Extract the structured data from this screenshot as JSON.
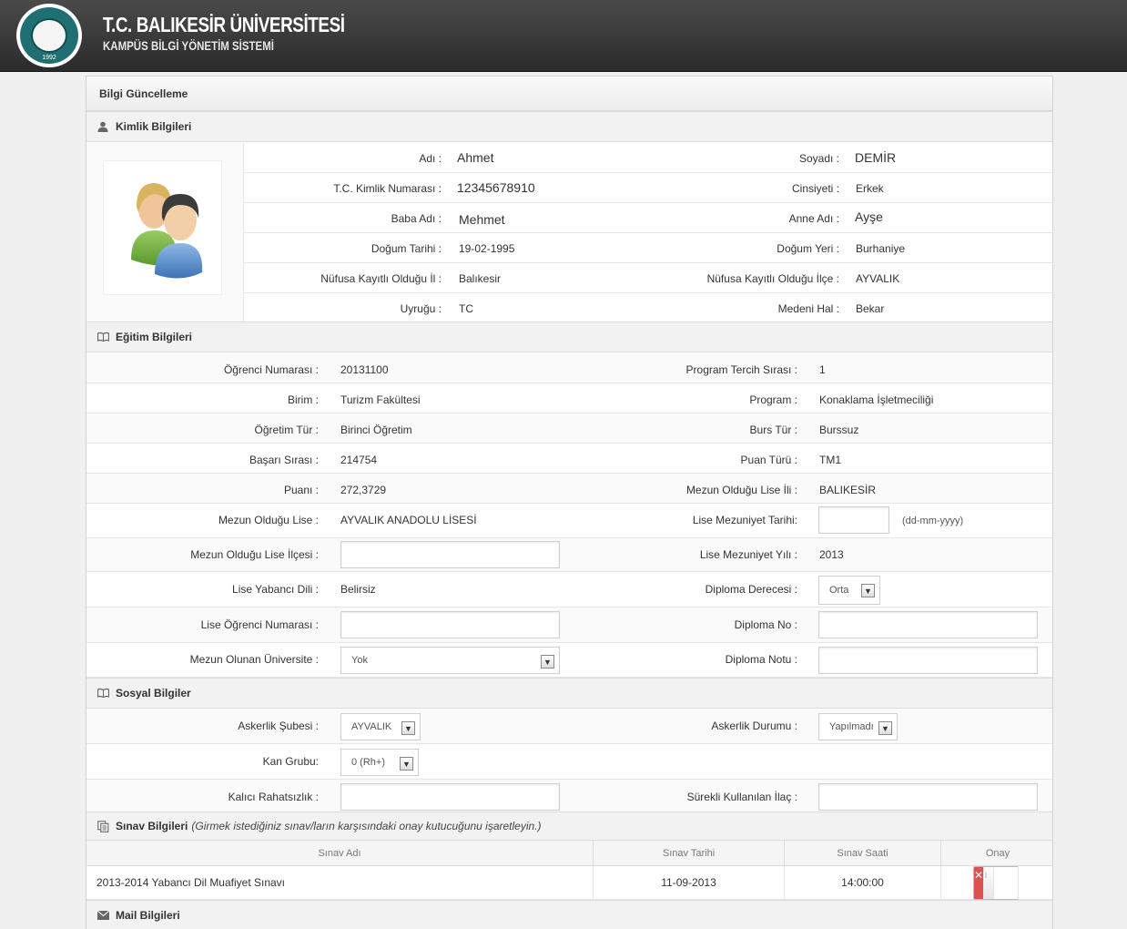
{
  "header": {
    "title": "T.C. BALIKESİR ÜNİVERSİTESİ",
    "subtitle": "KAMPÜS BİLGİ YÖNETİM SİSTEMİ",
    "logo_year": "1992"
  },
  "panel_title": "Bilgi Güncelleme",
  "kimlik": {
    "section_title": "Kimlik Bilgileri",
    "rows": [
      {
        "l1": "Adı :",
        "v1": "Ahmet",
        "l2": "Soyadı :",
        "v2": "DEMİR"
      },
      {
        "l1": "T.C. Kimlik Numarası :",
        "v1": "12345678910",
        "l2": "Cinsiyeti :",
        "v2": "Erkek"
      },
      {
        "l1": "Baba Adı :",
        "v1": "Mehmet",
        "l2": "Anne Adı :",
        "v2": "Ayşe"
      },
      {
        "l1": "Doğum Tarihi :",
        "v1": "19-02-1995",
        "l2": "Doğum Yeri :",
        "v2": "Burhaniye"
      },
      {
        "l1": "Nüfusa Kayıtlı Olduğu İl :",
        "v1": "Balıkesir",
        "l2": "Nüfusa Kayıtlı Olduğu İlçe :",
        "v2": "AYVALIK"
      },
      {
        "l1": "Uyruğu :",
        "v1": "TC",
        "l2": "Medeni Hal :",
        "v2": "Bekar"
      }
    ]
  },
  "egitim": {
    "section_title": "Eğitim Bilgileri",
    "ogrenci_no_label": "Öğrenci Numarası :",
    "ogrenci_no": "20131100",
    "tercih_label": "Program Tercih Sırası :",
    "tercih": "1",
    "birim_label": "Birim :",
    "birim": "Turizm Fakültesi",
    "program_label": "Program :",
    "program": "Konaklama İşletmeciliği",
    "ogretim_label": "Öğretim Tür :",
    "ogretim": "Birinci Öğretim",
    "burs_label": "Burs Tür :",
    "burs": "Burssuz",
    "basari_label": "Başarı Sırası :",
    "basari": "214754",
    "puan_turu_label": "Puan Türü :",
    "puan_turu": "TM1",
    "puan_label": "Puanı :",
    "puan": "272,3729",
    "lise_il_label": "Mezun Olduğu Lise İli :",
    "lise_il": "BALIKESİR",
    "lise_label": "Mezun Olduğu Lise :",
    "lise": "AYVALIK ANADOLU LİSESİ",
    "mezuniyet_tarihi_label": "Lise Mezuniyet Tarihi:",
    "mezuniyet_tarihi_hint": "(dd-mm-yyyy)",
    "lise_ilce_label": "Mezun Olduğu Lise İlçesi :",
    "mezuniyet_yili_label": "Lise Mezuniyet Yılı :",
    "mezuniyet_yili": "2013",
    "yabanci_dil_label": "Lise Yabancı Dili :",
    "yabanci_dil": "Belirsiz",
    "diploma_derecesi_label": "Diploma Derecesi :",
    "diploma_derecesi": "Orta",
    "lise_ogr_no_label": "Lise Öğrenci Numarası :",
    "diploma_no_label": "Diploma No :",
    "universite_label": "Mezun Olunan Üniversite :",
    "universite": "Yok",
    "diploma_notu_label": "Diploma Notu :"
  },
  "sosyal": {
    "section_title": "Sosyal Bilgiler",
    "askerlik_sube_label": "Askerlik Şubesi :",
    "askerlik_sube": "AYVALIK",
    "askerlik_durum_label": "Askerlik Durumu :",
    "askerlik_durum": "Yapılmadı",
    "kan_label": "Kan Grubu:",
    "kan": "0 (Rh+)",
    "rahatsizlik_label": "Kalıcı Rahatsızlık :",
    "ilac_label": "Sürekli Kullanılan İlaç :"
  },
  "sinav": {
    "section_title": "Sınav Bilgileri",
    "section_note": "(Girmek istediğiniz sınav/ların karşısındaki onay kutucuğunu işaretleyin.)",
    "columns": [
      "Sınav Adı",
      "Sınav Tarihi",
      "Sınav Saati",
      "Onay"
    ],
    "rows": [
      {
        "ad": "2013-2014 Yabancı Dil Muafiyet Sınavı",
        "tarih": "11-09-2013",
        "saat": "14:00:00"
      }
    ],
    "toggle_off": "III",
    "toggle_x": "✕"
  },
  "mail": {
    "section_title": "Mail Bilgileri"
  }
}
